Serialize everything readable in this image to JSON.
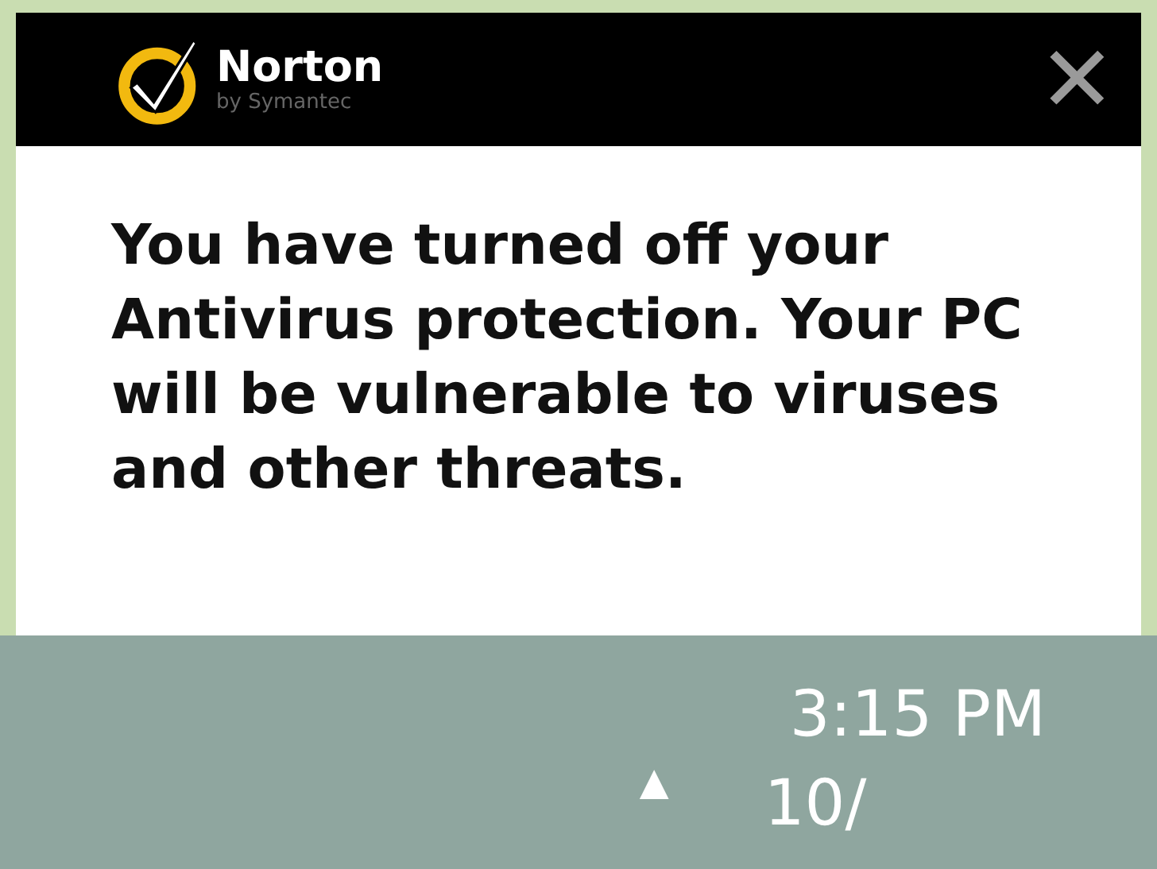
{
  "notification": {
    "brand": "Norton",
    "brand_subtitle": "by Symantec",
    "close": "✕",
    "message": "You have turned off your Antivirus protection. Your PC will be vulnerable to viruses and other threats."
  },
  "taskbar": {
    "tray_toggle": "▲",
    "time": "3:15 PM",
    "date": "10/"
  }
}
